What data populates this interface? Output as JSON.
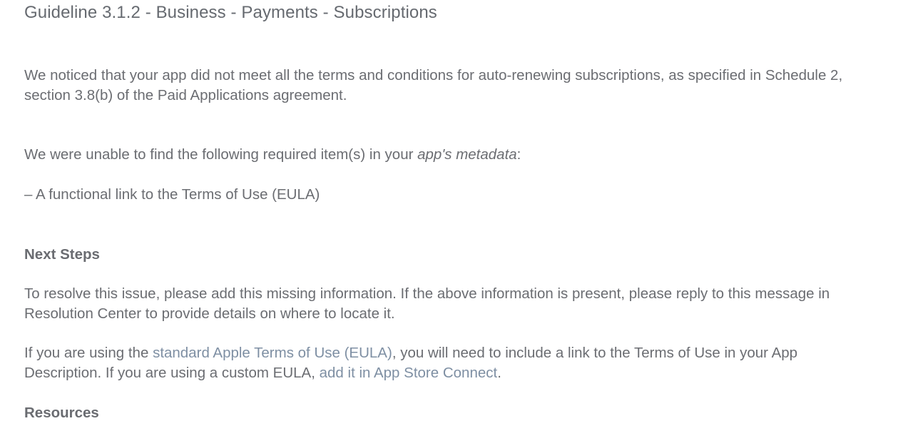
{
  "title": "Guideline 3.1.2 - Business - Payments - Subscriptions",
  "paragraph_1": "We noticed that your app did not meet all the terms and conditions for auto-renewing subscriptions, as specified in Schedule 2, section 3.8(b) of the Paid Applications agreement.",
  "paragraph_2": {
    "before": "We were unable to find the following required item(s) in your ",
    "emphasis": "app's metadata",
    "after": ":"
  },
  "required_item": "– A functional link to the Terms of Use (EULA)",
  "next_steps_heading": "Next Steps",
  "paragraph_3": "To resolve this issue, please add this missing information. If the above information is present, please reply to this message in Resolution Center to provide details on where to locate it.",
  "paragraph_4": {
    "part_1": "If you are using the ",
    "link_1": "standard Apple Terms of Use (EULA)",
    "part_2": ", you will need to include a link to the Terms of Use in your App Description. If you are using a custom EULA, ",
    "link_2": "add it in App Store Connect",
    "part_3": "."
  },
  "resources_heading": "Resources",
  "colors": {
    "text": "#6b6d72",
    "link": "#7e8fa3",
    "background": "#ffffff"
  }
}
